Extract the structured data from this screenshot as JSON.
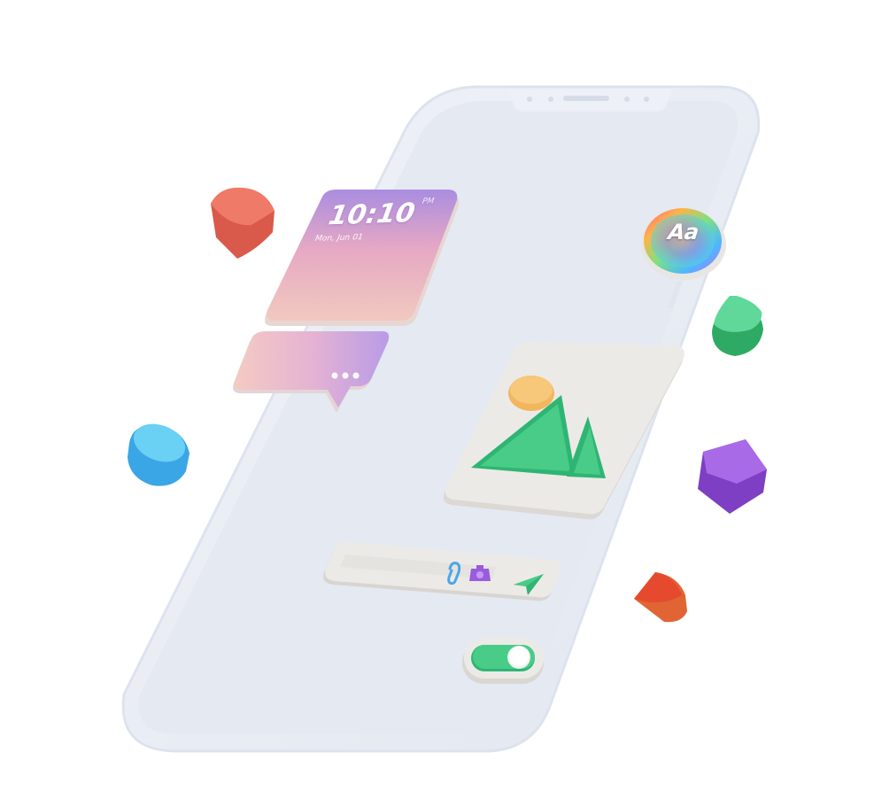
{
  "lock_widget": {
    "time": "10:10",
    "ampm": "PM",
    "date": "Mon, Jun 01"
  },
  "font_badge": {
    "label": "Aa"
  },
  "colors": {
    "phone_body": "#e9edf5",
    "phone_screen": "#e4e9f2",
    "accent_green": "#3ec785",
    "accent_purple": "#9a5bdc",
    "accent_blue": "#4cc3ec",
    "accent_red": "#e45a3c",
    "accent_coral": "#ec7866",
    "sun_yellow": "#f2b65c",
    "card_gray": "#eceae7"
  },
  "icons": {
    "image_card": "image-icon",
    "send": "send-icon",
    "attachment": "paperclip-icon",
    "camera": "camera-icon",
    "chat": "chat-bubble-icon",
    "toggle": "toggle-switch-icon"
  }
}
